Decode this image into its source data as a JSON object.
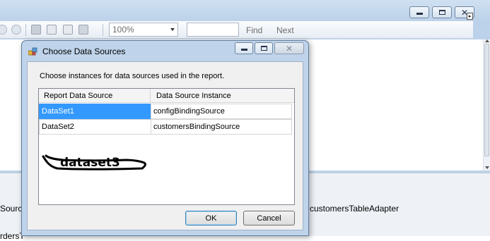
{
  "toolbar": {
    "zoom_value": "100%",
    "find_label": "Find",
    "next_label": "Next",
    "find_value": ""
  },
  "tray": {
    "left_top": "Sourc",
    "left_bottom": "rdersT",
    "right": "customersTableAdapter"
  },
  "dialog": {
    "title": "Choose Data Sources",
    "instruction": "Choose instances for data sources used in the report.",
    "columns": [
      "Report Data Source",
      "Data Source Instance"
    ],
    "rows": [
      {
        "source": "DataSet1",
        "instance": "configBindingSource",
        "selected": true
      },
      {
        "source": "DataSet2",
        "instance": "customersBindingSource",
        "selected": false
      }
    ],
    "annotation": "dataset3",
    "ok_label": "OK",
    "cancel_label": "Cancel"
  },
  "colors": {
    "selection": "#3399ff",
    "window_frame": "#bfd4ea"
  },
  "icons": [
    "minimize-icon",
    "maximize-icon",
    "close-icon",
    "print-icon",
    "page-layout-icon",
    "page-setup-icon",
    "export-icon",
    "dialog-app-icon"
  ]
}
